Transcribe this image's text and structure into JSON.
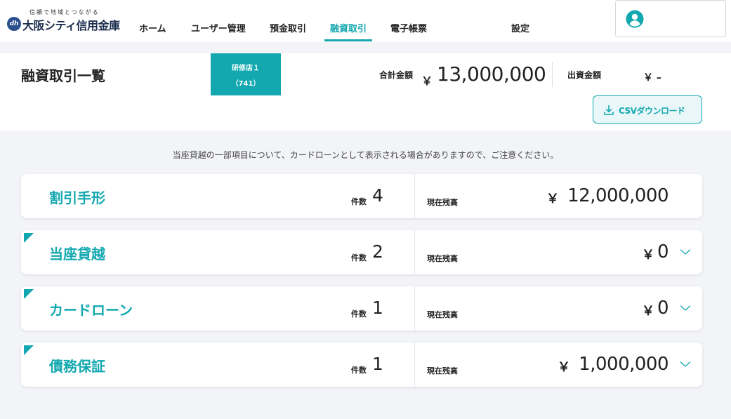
{
  "header": {
    "logo_tagline": "信頼で地域とつながる",
    "logo_name": "大阪シティ信用金庫",
    "nav": [
      {
        "label": "ホーム",
        "active": false
      },
      {
        "label": "ユーザー管理",
        "active": false
      },
      {
        "label": "預金取引",
        "active": false
      },
      {
        "label": "融資取引",
        "active": true
      },
      {
        "label": "電子帳票",
        "active": false
      },
      {
        "label": "設定",
        "active": false
      }
    ],
    "user_icon": "user-circle-icon"
  },
  "summary": {
    "title": "融資取引一覧",
    "branch_name": "研修店１",
    "branch_code": "（741）",
    "total_label": "合計金額",
    "total_currency": "￥",
    "total_value": "13,000,000",
    "investment_label": "出資金額",
    "investment_value": "￥ –",
    "csv_button": "CSVダウンロード",
    "csv_icon": "download-icon"
  },
  "notice": "当座貸越の一部項目について、カードローンとして表示される場合がありますので、ご注意ください。",
  "cards": [
    {
      "title": "割引手形",
      "count_label": "件数",
      "count": "4",
      "balance_label": "現在残高",
      "currency": "￥",
      "balance": "12,000,000",
      "expandable": false
    },
    {
      "title": "当座貸越",
      "count_label": "件数",
      "count": "2",
      "balance_label": "現在残高",
      "currency": "￥",
      "balance": "0",
      "expandable": true
    },
    {
      "title": "カードローン",
      "count_label": "件数",
      "count": "1",
      "balance_label": "現在残高",
      "currency": "￥",
      "balance": "0",
      "expandable": true
    },
    {
      "title": "債務保証",
      "count_label": "件数",
      "count": "1",
      "balance_label": "現在残高",
      "currency": "￥",
      "balance": "1,000,000",
      "expandable": true
    }
  ],
  "colors": {
    "accent": "#13a8b0",
    "background": "#f3f4f8",
    "text": "#222222"
  }
}
